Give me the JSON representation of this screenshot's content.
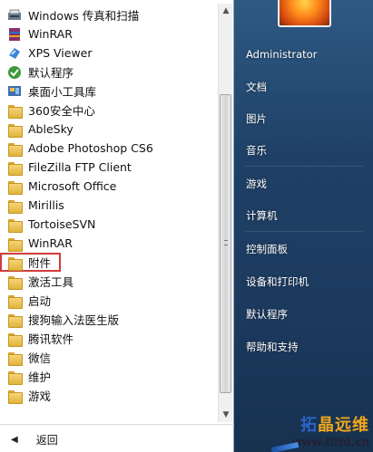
{
  "programs": [
    {
      "label": "Windows 传真和扫描",
      "icon": "fax-scan-icon"
    },
    {
      "label": "WinRAR",
      "icon": "winrar-icon"
    },
    {
      "label": "XPS Viewer",
      "icon": "xps-viewer-icon"
    },
    {
      "label": "默认程序",
      "icon": "default-programs-icon"
    },
    {
      "label": "桌面小工具库",
      "icon": "gadgets-icon"
    },
    {
      "label": "360安全中心",
      "icon": "folder-icon"
    },
    {
      "label": "AbleSky",
      "icon": "folder-icon"
    },
    {
      "label": "Adobe Photoshop CS6",
      "icon": "folder-icon"
    },
    {
      "label": "FileZilla FTP Client",
      "icon": "folder-icon"
    },
    {
      "label": "Microsoft Office",
      "icon": "folder-icon"
    },
    {
      "label": "Mirillis",
      "icon": "folder-icon"
    },
    {
      "label": "TortoiseSVN",
      "icon": "folder-icon"
    },
    {
      "label": "WinRAR",
      "icon": "folder-icon"
    },
    {
      "label": "附件",
      "icon": "folder-icon",
      "selected": true
    },
    {
      "label": "激活工具",
      "icon": "folder-icon"
    },
    {
      "label": "启动",
      "icon": "folder-icon"
    },
    {
      "label": "搜狗输入法医生版",
      "icon": "folder-icon"
    },
    {
      "label": "腾讯软件",
      "icon": "folder-icon"
    },
    {
      "label": "微信",
      "icon": "folder-icon"
    },
    {
      "label": "维护",
      "icon": "folder-icon"
    },
    {
      "label": "游戏",
      "icon": "folder-icon"
    }
  ],
  "back": {
    "label": "返回"
  },
  "right_menu": {
    "user": "Administrator",
    "documents": "文档",
    "pictures": "图片",
    "music": "音乐",
    "games": "游戏",
    "computer": "计算机",
    "control_panel": "控制面板",
    "devices_printers": "设备和打印机",
    "default_programs": "默认程序",
    "help_support": "帮助和支持"
  },
  "watermark": {
    "brand_blue": "拓",
    "brand_rest": "晶远维",
    "url": "www.tlltd.cn"
  },
  "colors": {
    "selection_outline": "#d23b3b",
    "right_pane_top": "#2e5a84",
    "right_pane_bottom": "#17314f"
  }
}
